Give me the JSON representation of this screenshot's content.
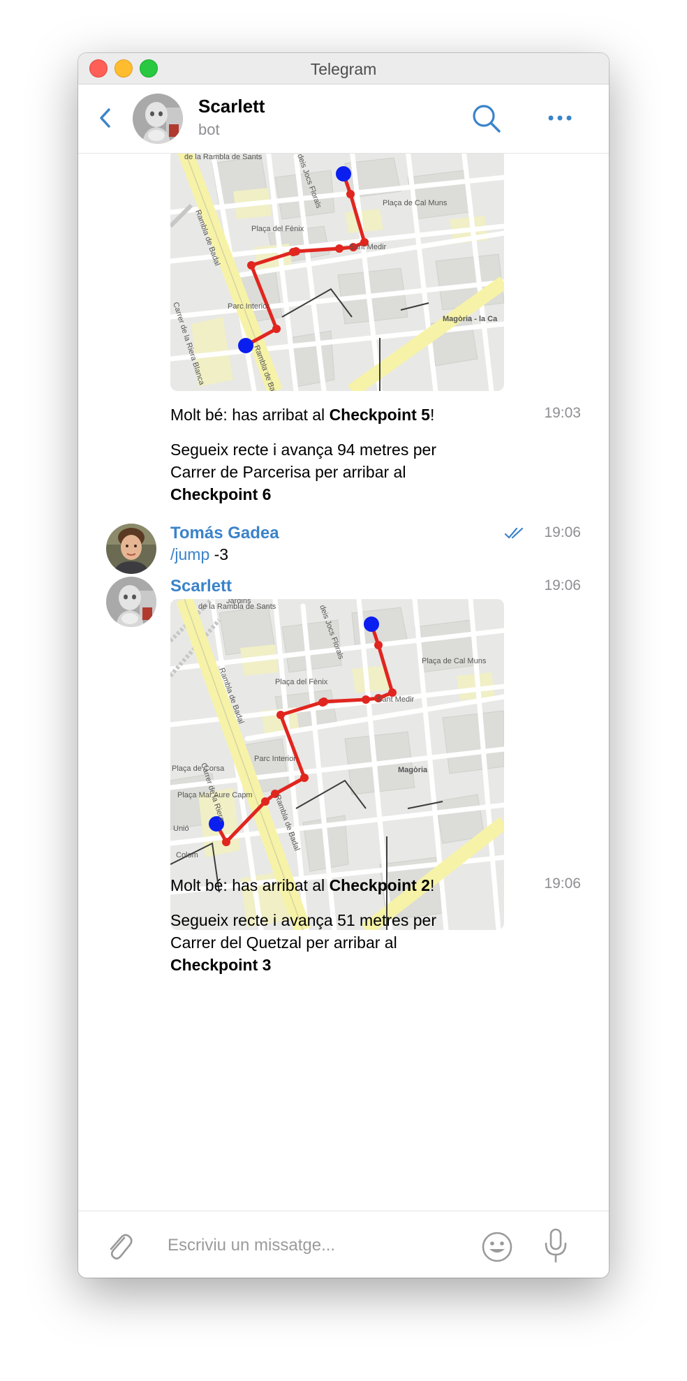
{
  "window": {
    "title": "Telegram"
  },
  "header": {
    "name": "Scarlett",
    "status": "bot",
    "icons": {
      "back": "chevron-left-icon",
      "search": "search-icon",
      "more": "more-horizontal-icon"
    }
  },
  "messages": [
    {
      "kind": "map-with-caption",
      "sender": "Scarlett",
      "map": {
        "labels": [
          "de la Rambla de Sants",
          "deis Jocs Florals",
          "Plaça de Cal Muns",
          "Plaça del Fènix",
          "Sant Medir",
          "Rambla de Badal",
          "Parc Interior",
          "Magòria - la Ca",
          "Carrer de la Riera Blanca",
          "Rambla de Badal"
        ]
      },
      "caption": {
        "p1_pre": "Molt bé: has arribat al ",
        "p1_bold": "Checkpoint 5",
        "p1_post": "!",
        "p2_pre": "Segueix recte i avança 94 metres per Carrer de Parcerisa per arribar al ",
        "p2_bold": "Checkpoint 6"
      },
      "time": "19:03"
    },
    {
      "kind": "command",
      "sender": "Tomás Gadea",
      "command": "/jump",
      "argument": " -3",
      "time": "19:06",
      "read": true
    },
    {
      "kind": "map-with-caption",
      "sender": "Scarlett",
      "time": "19:06",
      "map": {
        "labels": [
          "de la Rambla de Sants",
          "Jardins",
          "deis Jocs Florals",
          "Plaça de Cal Muns",
          "Plaça del Fènix",
          "Sant Medir",
          "Rambla de Badal",
          "Parc Interior",
          "Magòria",
          "Plaça de Corsa",
          "Plaça Mar Aure Capm",
          "Carrer de la Riera",
          "Unió",
          "Colom",
          "Rambla de Badal"
        ]
      },
      "caption": {
        "p1_pre": "Molt bé: has arribat al ",
        "p1_bold": "Checkpoint 2",
        "p1_post": "!",
        "p2_pre": "Segueix recte i avança 51 metres per Carrer del Quetzal per arribar al ",
        "p2_bold": "Checkpoint 3"
      },
      "caption_time": "19:06"
    }
  ],
  "composer": {
    "placeholder": "Escriviu un missatge...",
    "icons": {
      "attach": "paperclip-icon",
      "emoji": "emoji-icon",
      "mic": "microphone-icon"
    }
  },
  "colors": {
    "accent": "#3a83c9",
    "route": "#e0261f",
    "marker": "#0a1ef0",
    "map_bg": "#e8e8e6",
    "map_yellow": "#f6f3a8"
  }
}
